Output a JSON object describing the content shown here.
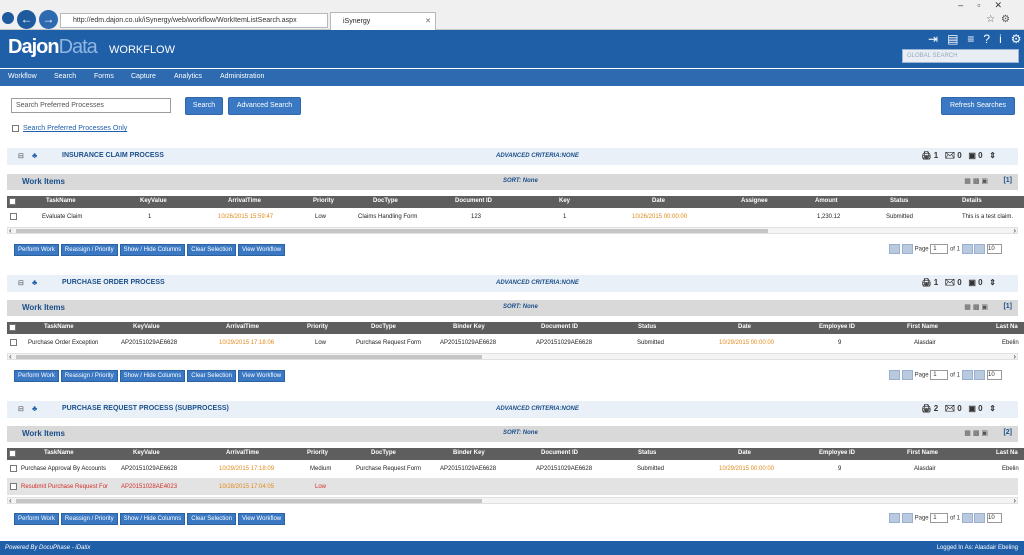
{
  "browser": {
    "url": "http://edm.dajon.co.uk/iSynergy/web/workflow/WorkItemListSearch.aspx",
    "tab_title": "iSynergy"
  },
  "brand": {
    "logo_text": "Dajon",
    "logo_sub": "Data",
    "subtitle": "WORKFLOW",
    "global_search_placeholder": "GLOBAL SEARCH"
  },
  "menu": [
    "Workflow",
    "Search",
    "Forms",
    "Capture",
    "Analytics",
    "Administration"
  ],
  "search": {
    "placeholder": "Search Preferred Processes",
    "search_btn": "Search",
    "advanced_btn": "Advanced Search",
    "refresh_btn": "Refresh Searches",
    "only_label": "Search Preferred Processes Only"
  },
  "common": {
    "work_items": "Work Items",
    "sort": "SORT: None",
    "adv": "ADVANCED CRITERIA:NONE",
    "page": "Page",
    "of1": "of 1",
    "page_value": "1",
    "page_size": "10"
  },
  "actions": [
    "Perform Work",
    "Reassign / Priority",
    "Show / Hide Columns",
    "Clear Selection",
    "View Workflow"
  ],
  "sec1": {
    "title": "INSURANCE CLAIM PROCESS",
    "stats": [
      "1",
      "0",
      "0"
    ],
    "count": "[1]",
    "cols": [
      "TaskName",
      "KeyValue",
      "ArrivalTime",
      "Priority",
      "DocType",
      "Document ID",
      "Key",
      "Date",
      "Assignee",
      "Amount",
      "Status",
      "Details"
    ],
    "row": [
      "Evaluate Claim",
      "1",
      "10/26/2015 15:59:47",
      "Low",
      "Claims Handling Form",
      "123",
      "1",
      "10/26/2015 00:00:00",
      "",
      "1,230.12",
      "Submitted",
      "This is a test claim."
    ]
  },
  "sec2": {
    "title": "PURCHASE ORDER PROCESS",
    "stats": [
      "1",
      "0",
      "0"
    ],
    "count": "[1]",
    "cols": [
      "TaskName",
      "KeyValue",
      "ArrivalTime",
      "Priority",
      "DocType",
      "Binder Key",
      "Document ID",
      "Status",
      "Date",
      "Employee ID",
      "First Name",
      "Last Na"
    ],
    "row": [
      "Purchase Order Exception",
      "AP20151029AE6628",
      "10/29/2015 17:18:06",
      "Low",
      "Purchase Request Form",
      "AP20151029AE6628",
      "AP20151029AE6628",
      "Submitted",
      "10/29/2015 00:00:00",
      "9",
      "Alasdair",
      "Ebelin"
    ]
  },
  "sec3": {
    "title": "PURCHASE REQUEST PROCESS (SUBPROCESS)",
    "stats": [
      "2",
      "0",
      "0"
    ],
    "count": "[2]",
    "cols": [
      "TaskName",
      "KeyValue",
      "ArrivalTime",
      "Priority",
      "DocType",
      "Binder Key",
      "Document ID",
      "Status",
      "Date",
      "Employee ID",
      "First Name",
      "Last Na"
    ],
    "row": [
      "Purchase Approval By Accounts",
      "AP20151029AE6628",
      "10/29/2015 17:18:09",
      "Medium",
      "Purchase Request Form",
      "AP20151029AE6628",
      "AP20151029AE6628",
      "Submitted",
      "10/29/2015 00:00:00",
      "9",
      "Alasdair",
      "Ebelin"
    ],
    "row2": [
      "Resubmit Purchase Request For",
      "AP20151028AE4023",
      "10/28/2015 17:04:05",
      "Low"
    ]
  },
  "footer": {
    "left": "Powered By DocuPhase - iDatix",
    "right": "Logged In As: Alasdair Ebeling"
  }
}
